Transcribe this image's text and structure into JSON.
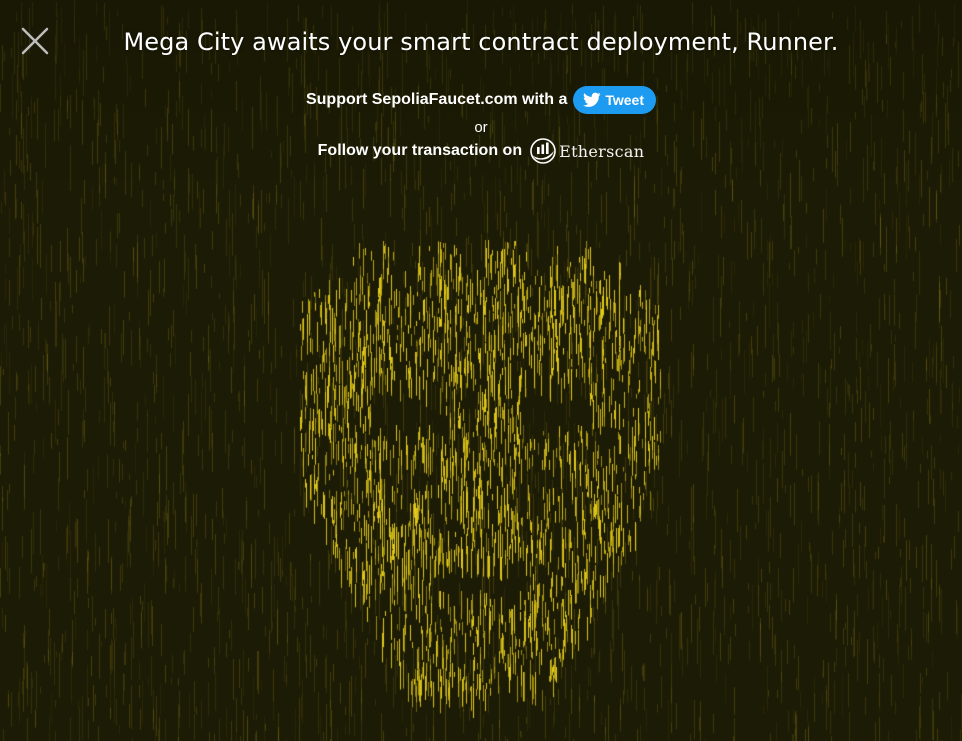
{
  "headline": "Mega City awaits your smart contract deployment, Runner.",
  "support": {
    "text": "Support SepoliaFaucet.com with a",
    "tweet_label": "Tweet"
  },
  "or_text": "or",
  "follow": {
    "text": "Follow your transaction on",
    "etherscan_label": "Etherscan"
  },
  "icons": {
    "close": "close-icon",
    "twitter": "twitter-bird-icon",
    "etherscan": "etherscan-logo-icon"
  },
  "colors": {
    "background": "#1c1b05",
    "rain": "#d8c21a",
    "tweet_button": "#1d9bf0",
    "text": "#ffffff"
  }
}
